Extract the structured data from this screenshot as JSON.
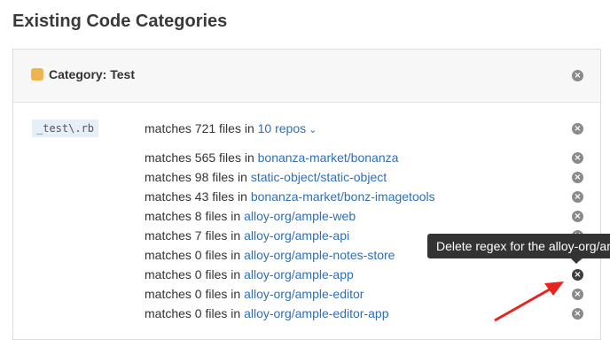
{
  "page": {
    "title": "Existing Code Categories"
  },
  "category": {
    "header": "Category: Test",
    "swatch_color": "#f0b352",
    "regex": "_test\\.rb",
    "summary": {
      "prefix": "matches 721 files in",
      "repos_link": "10 repos"
    },
    "rows": [
      {
        "prefix": "matches 565 files in",
        "repo": "bonanza-market/bonanza"
      },
      {
        "prefix": "matches 98 files in",
        "repo": "static-object/static-object"
      },
      {
        "prefix": "matches 43 files in",
        "repo": "bonanza-market/bonz-imagetools"
      },
      {
        "prefix": "matches 8 files in",
        "repo": "alloy-org/ample-web"
      },
      {
        "prefix": "matches 7 files in",
        "repo": "alloy-org/ample-api"
      },
      {
        "prefix": "matches 0 files in",
        "repo": "alloy-org/ample-notes-store"
      },
      {
        "prefix": "matches 0 files in",
        "repo": "alloy-org/ample-app"
      },
      {
        "prefix": "matches 0 files in",
        "repo": "alloy-org/ample-editor"
      },
      {
        "prefix": "matches 0 files in",
        "repo": "alloy-org/ample-editor-app"
      }
    ]
  },
  "tooltip": {
    "text": "Delete regex for the alloy-org/ample-app"
  },
  "icons": {
    "close": "close-icon",
    "chevron": "chevron-down-icon"
  },
  "colors": {
    "link": "#2f6fb8",
    "annotation_arrow": "#e8231f"
  }
}
